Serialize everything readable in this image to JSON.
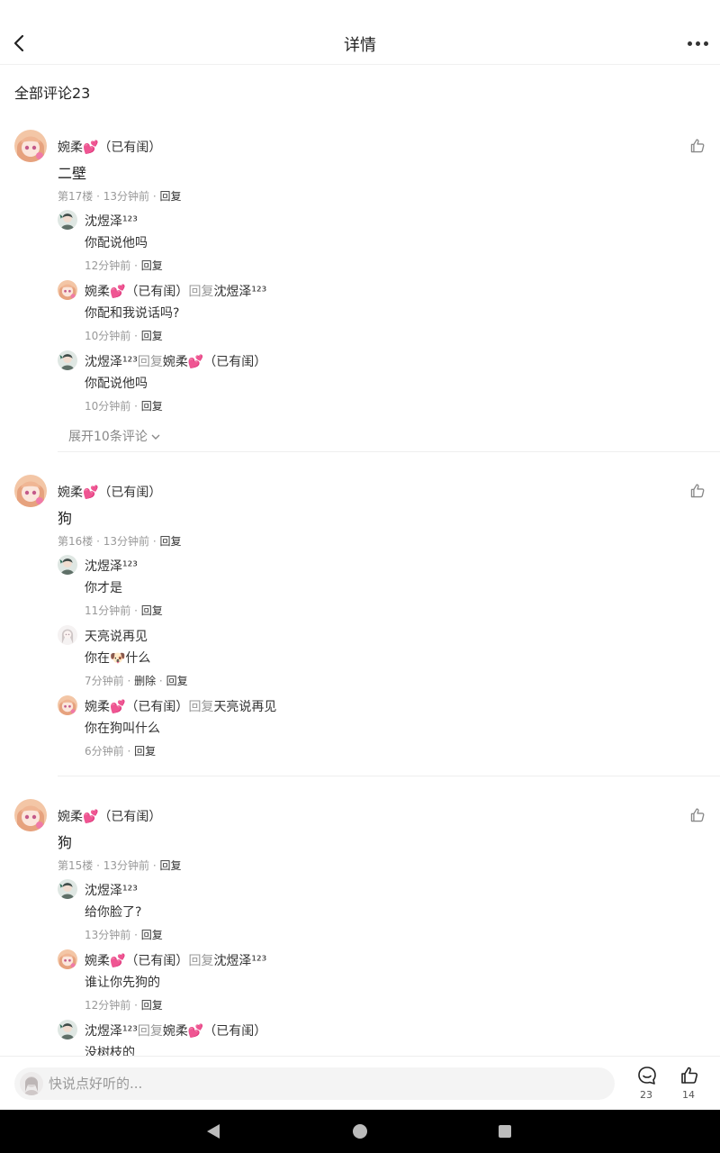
{
  "header": {
    "title": "详情"
  },
  "comments_title": "全部评论23",
  "comments": [
    {
      "name": "婉柔💕（已有闺）",
      "text": "二壁",
      "floor": "第17楼",
      "time": "13分钟前",
      "reply_label": "回复",
      "replies": [
        {
          "avatar": "boy",
          "name": "沈煜泽¹²³",
          "reply_word": "",
          "target": "",
          "text": "你配说他吗",
          "time": "12分钟前",
          "delete_label": "",
          "reply_label": "回复"
        },
        {
          "avatar": "girl",
          "name": "婉柔💕（已有闺）",
          "reply_word": "回复",
          "target": "沈煜泽¹²³",
          "text": "你配和我说话吗?",
          "time": "10分钟前",
          "delete_label": "",
          "reply_label": "回复"
        },
        {
          "avatar": "boy",
          "name": "沈煜泽¹²³",
          "reply_word": "回复",
          "target": "婉柔💕（已有闺）",
          "text": "你配说他吗",
          "time": "10分钟前",
          "delete_label": "",
          "reply_label": "回复"
        }
      ],
      "expand_label": "展开10条评论"
    },
    {
      "name": "婉柔💕（已有闺）",
      "text": "狗",
      "floor": "第16楼",
      "time": "13分钟前",
      "reply_label": "回复",
      "replies": [
        {
          "avatar": "boy",
          "name": "沈煜泽¹²³",
          "reply_word": "",
          "target": "",
          "text": "你才是",
          "time": "11分钟前",
          "delete_label": "",
          "reply_label": "回复"
        },
        {
          "avatar": "white",
          "name": "天亮说再见",
          "reply_word": "",
          "target": "",
          "text": "你在🐶什么",
          "time": "7分钟前",
          "delete_label": "删除",
          "reply_label": "回复"
        },
        {
          "avatar": "girl",
          "name": "婉柔💕（已有闺）",
          "reply_word": "回复",
          "target": "天亮说再见",
          "text": "你在狗叫什么",
          "time": "6分钟前",
          "delete_label": "",
          "reply_label": "回复"
        }
      ]
    },
    {
      "name": "婉柔💕（已有闺）",
      "text": "狗",
      "floor": "第15楼",
      "time": "13分钟前",
      "reply_label": "回复",
      "replies": [
        {
          "avatar": "boy",
          "name": "沈煜泽¹²³",
          "reply_word": "",
          "target": "",
          "text": "给你脸了?",
          "time": "13分钟前",
          "delete_label": "",
          "reply_label": "回复"
        },
        {
          "avatar": "girl",
          "name": "婉柔💕（已有闺）",
          "reply_word": "回复",
          "target": "沈煜泽¹²³",
          "text": "谁让你先狗的",
          "time": "12分钟前",
          "delete_label": "",
          "reply_label": "回复"
        },
        {
          "avatar": "boy",
          "name": "沈煜泽¹²³",
          "reply_word": "回复",
          "target": "婉柔💕（已有闺）",
          "text": "没树枝的",
          "time": "",
          "delete_label": "",
          "reply_label": ""
        }
      ]
    }
  ],
  "bottom": {
    "input_placeholder": "快说点好听的...",
    "comment_count": "23",
    "like_count": "14"
  },
  "icons": {
    "back": "chevron-left-icon",
    "more": "more-dots-icon",
    "like": "thumbs-up-icon",
    "comment": "comment-bubble-icon",
    "expand": "chevron-down-icon"
  }
}
